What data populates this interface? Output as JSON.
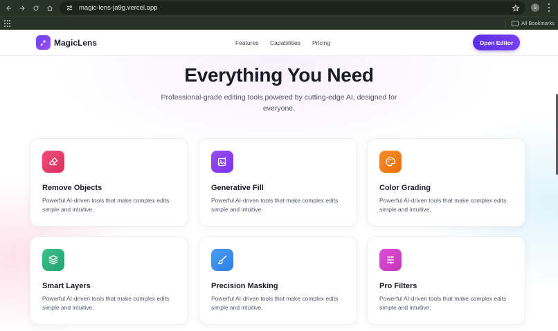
{
  "browser": {
    "url": "magic-lens-ja9g.vercel.app",
    "profile_initial": "S",
    "bookmarks_label": "All Bookmarks"
  },
  "header": {
    "brand": "MagicLens",
    "nav": [
      "Features",
      "Capabilities",
      "Pricing"
    ],
    "cta": "Open Editor"
  },
  "hero": {
    "title": "Everything You Need",
    "subtitle": "Professional-grade editing tools powered by cutting-edge AI, designed for everyone."
  },
  "features": [
    {
      "title": "Remove Objects",
      "description": "Powerful AI-driven tools that make complex edits simple and intuitive.",
      "icon": "eraser-icon",
      "color": "#e5386a"
    },
    {
      "title": "Generative Fill",
      "description": "Powerful AI-driven tools that make complex edits simple and intuitive.",
      "icon": "image-sparkle-icon",
      "color": "#8b3ff2"
    },
    {
      "title": "Color Grading",
      "description": "Powerful AI-driven tools that make complex edits simple and intuitive.",
      "icon": "palette-icon",
      "color": "#f07d16"
    },
    {
      "title": "Smart Layers",
      "description": "Powerful AI-driven tools that make complex edits simple and intuitive.",
      "icon": "layers-icon",
      "color": "#2fb37f"
    },
    {
      "title": "Precision Masking",
      "description": "Powerful AI-driven tools that make complex edits simple and intuitive.",
      "icon": "brush-icon",
      "color": "#3b8ff0"
    },
    {
      "title": "Pro Filters",
      "description": "Powerful AI-driven tools that make complex edits simple and intuitive.",
      "icon": "sliders-icon",
      "color": "#d63fc9"
    }
  ]
}
